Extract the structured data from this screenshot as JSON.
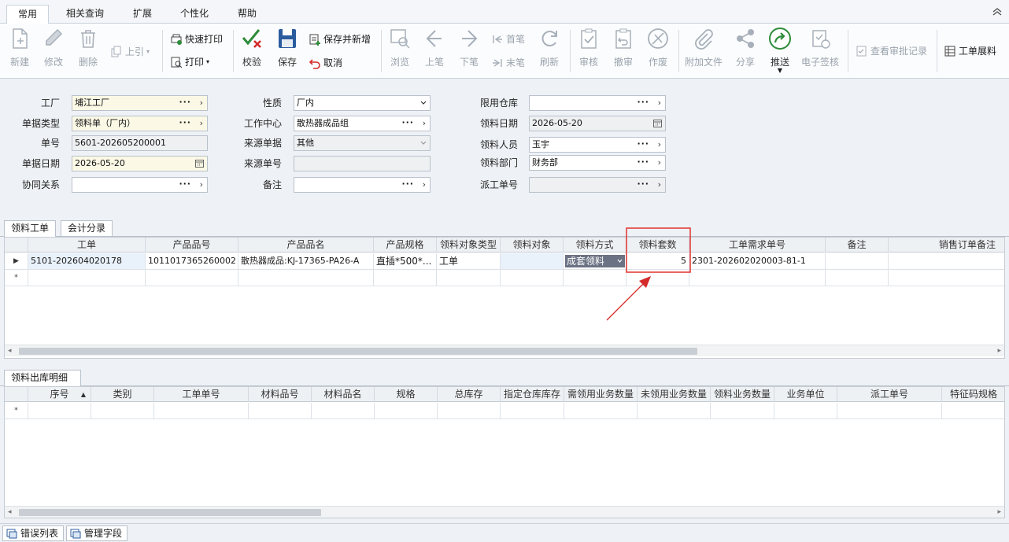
{
  "ribbon": {
    "tabs": [
      "常用",
      "相关查询",
      "扩展",
      "个性化",
      "帮助"
    ],
    "active_tab": "常用"
  },
  "toolbar": {
    "new": "新建",
    "edit": "修改",
    "delete": "删除",
    "prev_ref": "上引",
    "quick_print": "快速打印",
    "print": "打印",
    "verify": "校验",
    "save": "保存",
    "save_new": "保存并新增",
    "cancel": "取消",
    "browse": "浏览",
    "prev": "上笔",
    "next": "下笔",
    "first": "首笔",
    "last": "末笔",
    "refresh": "刷新",
    "audit": "审核",
    "unaudit": "撤审",
    "void": "作废",
    "attach": "附加文件",
    "share": "分享",
    "push": "推送",
    "esign": "电子签核",
    "view_approval": "查看审批记录",
    "wo_expand": "工单展料"
  },
  "form": {
    "factory_label": "工厂",
    "factory_value": "埔江工厂",
    "doctype_label": "单据类型",
    "doctype_value": "领料单（厂内）",
    "docno_label": "单号",
    "docno_value": "5601-202605200001",
    "docdate_label": "单据日期",
    "docdate_value": "2026-05-20",
    "collab_label": "协同关系",
    "collab_value": "",
    "nature_label": "性质",
    "nature_value": "厂内",
    "workcenter_label": "工作中心",
    "workcenter_value": "散热器成品组",
    "source_doc_label": "来源单据",
    "source_doc_value": "其他",
    "source_no_label": "来源单号",
    "source_no_value": "",
    "remark_label": "备注",
    "remark_value": "",
    "warehouse_label": "限用仓库",
    "warehouse_value": "",
    "pick_date_label": "领料日期",
    "pick_date_value": "2026-05-20",
    "picker_label": "领料人员",
    "picker_value": "玉宇",
    "dept_label": "领料部门",
    "dept_value": "财务部",
    "dispatch_label": "派工单号",
    "dispatch_value": ""
  },
  "upper_tabs": [
    "领料工单",
    "会计分录"
  ],
  "upper_grid": {
    "headers": [
      "工单",
      "产品品号",
      "产品品名",
      "产品规格",
      "领料对象类型",
      "领料对象",
      "领料方式",
      "领料套数",
      "工单需求单号",
      "备注",
      "销售订单备注"
    ],
    "row": {
      "wo": "5101-202604020178",
      "product_no": "1011017365260002",
      "product_name": "散热器成品:KJ-17365-PA26-A",
      "spec": "直插*500*...",
      "obj_type": "工单",
      "obj": "",
      "method": "成套领料",
      "sets": "5",
      "req_no": "2301-202602020003-81-1",
      "remark": "",
      "so_remark": ""
    },
    "new_row_marker": "*"
  },
  "lower_tabs": [
    "领料出库明细"
  ],
  "lower_grid": {
    "headers": [
      "序号",
      "类别",
      "工单单号",
      "材料品号",
      "材料品名",
      "规格",
      "总库存",
      "指定仓库库存",
      "需领用业务数量",
      "未领用业务数量",
      "领料业务数量",
      "业务单位",
      "派工单号",
      "特征码规格"
    ],
    "new_row_marker": "*"
  },
  "bottom_tabs": [
    "错误列表",
    "管理字段"
  ],
  "colors": {
    "highlight_box": "#e0322e",
    "annotation_arrow": "#d42a2a",
    "required_field_bg": "#fbf9e6",
    "selected_cell_bg": "#6b7283"
  }
}
